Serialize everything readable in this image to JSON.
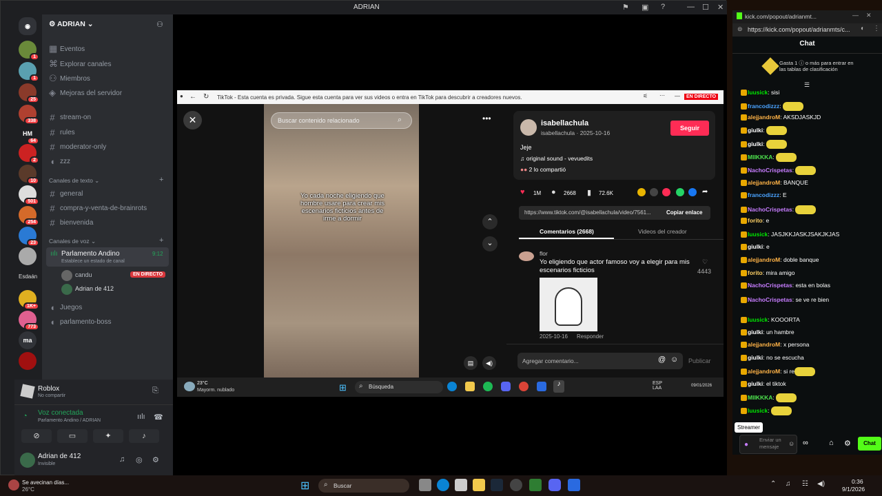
{
  "window": {
    "title": "ADRIAN"
  },
  "server": {
    "name": "ADRIAN"
  },
  "nav": [
    "Eventos",
    "Explorar canales",
    "Miembros",
    "Mejoras del servidor"
  ],
  "channels_top": [
    "stream-on",
    "rules",
    "moderator-only",
    "zzz"
  ],
  "cat_text": "Canales de texto",
  "channels_text": [
    "general",
    "compra-y-venta-de-brainrots",
    "bienvenida"
  ],
  "cat_voice": "Canales de voz",
  "voice": {
    "name": "Parlamento Andino",
    "time": "9:12",
    "status": "Establece un estado de canal",
    "users": [
      {
        "name": "candu",
        "badge": "EN DIRECTO"
      },
      {
        "name": "Adrian de 412"
      }
    ]
  },
  "channels_voice": [
    "Juegos",
    "parlamento-boss"
  ],
  "badges": [
    "1",
    "1",
    "25",
    "338",
    "64",
    "2",
    "10",
    "501",
    "254",
    "23",
    "1K+",
    "773"
  ],
  "server_labels": [
    "HM",
    "Esdaán",
    "ma"
  ],
  "activity": {
    "title": "Roblox",
    "sub": "No compartir"
  },
  "voice_conn": {
    "title": "Voz conectada",
    "sub": "Parlamento Andino / ADRIAN"
  },
  "user": {
    "name": "Adrian de 412",
    "status": "Invisible"
  },
  "tiktok": {
    "bar_text": "TikTok - Esta cuenta es privada. Sigue esta cuenta para ver sus videos o entra en TikTok para descubrir a creadores nuevos.",
    "bar_badge": "EN DIRECTO",
    "search": "Buscar contenido relacionado",
    "caption": "Yo cada noche eligiendo que hombre usare para crear mis escenarios ficticios antes de irme a dormir",
    "author": "isabellachula",
    "author_sub": "isabellachula · 2025-10-16",
    "follow": "Seguir",
    "desc": "Jeje",
    "sound": "original sound - vevuedits",
    "shared": "2 lo compartió",
    "likes": "1M",
    "comments": "2668",
    "saves": "72.6K",
    "link": "https://www.tiktok.com/@isabellachula/video/7561...",
    "copy": "Copiar enlace",
    "tab1": "Comentarios (2668)",
    "tab2": "Videos del creador",
    "c_user": "flor",
    "c_text": "Yo eligiendo que actor famoso voy a elegir para mis escenarios ficticios",
    "c_likes": "4443",
    "c_date": "2025-10-16",
    "c_reply": "Responder",
    "add": "Agregar comentario...",
    "publish": "Publicar"
  },
  "inner_taskbar": {
    "temp": "23°C",
    "weather": "Mayorm. nublado",
    "search": "Búsqueda",
    "lang": "ESP\nLAA",
    "time": "09/01/2026"
  },
  "kick": {
    "tab": "kick.com/popout/adrianmt...",
    "url": "https://kick.com/popout/adrianmts/c...",
    "title": "Chat",
    "promo": "Gasta 1 ⓘ o más para entrar en las tablas de clasificación",
    "messages": [
      {
        "u": "luusick",
        "c": "#00e701",
        "t": "sisi"
      },
      {
        "u": "francodizzz",
        "c": "#4aa3ff",
        "t": ""
      },
      {
        "u": "alejjandroM",
        "c": "#ffb347",
        "t": "AKSDJASKJD"
      },
      {
        "u": "giulki",
        "c": "#ffffff",
        "t": ""
      },
      {
        "u": "giulki",
        "c": "#ffffff",
        "t": ""
      },
      {
        "u": "MIIKKKA",
        "c": "#4ee44e",
        "t": ""
      },
      {
        "u": "NachoCrispetas",
        "c": "#c77dff",
        "t": ""
      },
      {
        "u": "alejjandroM",
        "c": "#ffb347",
        "t": "BANQUE"
      },
      {
        "u": "francodizzz",
        "c": "#4aa3ff",
        "t": "E"
      },
      {
        "u": "NachoCrispetas",
        "c": "#c77dff",
        "t": ""
      },
      {
        "u": "forito",
        "c": "#ffd166",
        "t": "e"
      },
      {
        "u": "luusick",
        "c": "#00e701",
        "t": "JASJKKJASKJSAKJKJAS"
      },
      {
        "u": "giulki",
        "c": "#ffffff",
        "t": "e"
      },
      {
        "u": "alejjandroM",
        "c": "#ffb347",
        "t": "doble banque"
      },
      {
        "u": "forito",
        "c": "#ffd166",
        "t": "mira amigo"
      },
      {
        "u": "NachoCrispetas",
        "c": "#c77dff",
        "t": "esta en bolas"
      },
      {
        "u": "NachoCrispetas",
        "c": "#c77dff",
        "t": "se ve re bien"
      },
      {
        "u": "luusick",
        "c": "#00e701",
        "t": "KOOORTA"
      },
      {
        "u": "giulki",
        "c": "#ffffff",
        "t": "un hambre"
      },
      {
        "u": "alejjandroM",
        "c": "#ffb347",
        "t": "x persona"
      },
      {
        "u": "giulki",
        "c": "#ffffff",
        "t": "no se escucha"
      },
      {
        "u": "alejjandroM",
        "c": "#ffb347",
        "t": "si re"
      },
      {
        "u": "giulki",
        "c": "#ffffff",
        "t": "el tiktok"
      },
      {
        "u": "MIIKKKA",
        "c": "#4ee44e",
        "t": ""
      },
      {
        "u": "luusick",
        "c": "#00e701",
        "t": ""
      }
    ],
    "tooltip": "Streamer",
    "input": "Enviar un mensaje",
    "send": "Chat"
  },
  "taskbar": {
    "weather": "Se avecinan días...",
    "temp": "26°C",
    "search": "Buscar",
    "time": "0:36",
    "date": "9/1/2026"
  }
}
